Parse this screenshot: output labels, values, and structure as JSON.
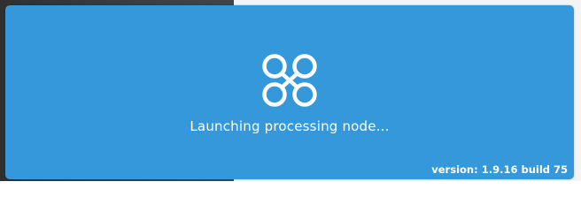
{
  "splash": {
    "logo_icon": "drone-quadcopter-icon",
    "message": "Launching processing node...",
    "version": "version: 1.9.16 build 75"
  },
  "colors": {
    "accent": "#3598db",
    "text": "#ffffff"
  }
}
